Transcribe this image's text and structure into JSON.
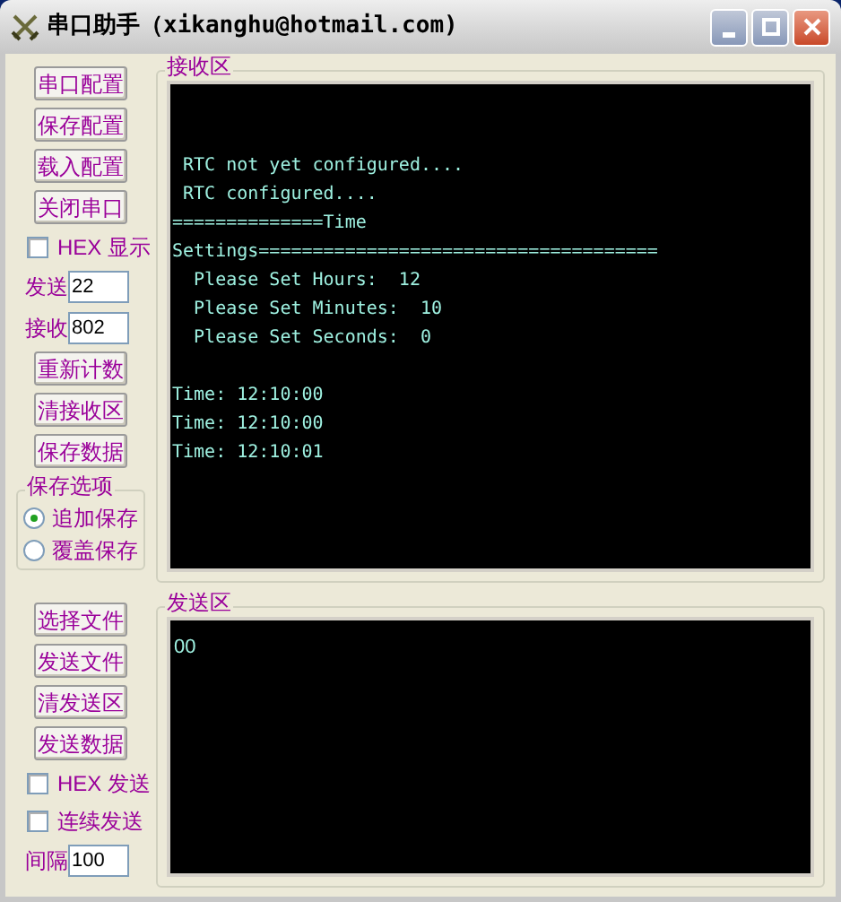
{
  "window": {
    "title": "串口助手（xikanghu@hotmail.com)"
  },
  "top_controls": [
    {
      "kind": "button",
      "label": "串口配置"
    },
    {
      "kind": "button",
      "label": "保存配置"
    },
    {
      "kind": "button",
      "label": "载入配置"
    },
    {
      "kind": "button",
      "label": "关闭串口"
    },
    {
      "kind": "checkbox",
      "label": "HEX 显示",
      "checked": false
    },
    {
      "kind": "field",
      "label": "发送",
      "value": "22"
    },
    {
      "kind": "field",
      "label": "接收",
      "value": "802"
    },
    {
      "kind": "button",
      "label": "重新计数"
    },
    {
      "kind": "button",
      "label": "清接收区"
    },
    {
      "kind": "button",
      "label": "保存数据"
    }
  ],
  "save_options": {
    "title": "保存选项",
    "options": [
      {
        "label": "追加保存",
        "selected": true
      },
      {
        "label": "覆盖保存",
        "selected": false
      }
    ]
  },
  "bottom_controls": [
    {
      "kind": "button",
      "label": "选择文件"
    },
    {
      "kind": "button",
      "label": "发送文件"
    },
    {
      "kind": "button",
      "label": "清发送区"
    },
    {
      "kind": "button",
      "label": "发送数据"
    },
    {
      "kind": "checkbox",
      "label": "HEX 发送",
      "checked": false
    },
    {
      "kind": "checkbox",
      "label": "连续发送",
      "checked": false
    },
    {
      "kind": "field",
      "label": "间隔",
      "value": "100"
    }
  ],
  "receive_area": {
    "title": "接收区",
    "blocks": [
      [
        " RTC not yet configured....",
        " RTC configured....",
        "==============Time",
        "Settings=====================================",
        "  Please Set Hours:  12",
        "  Please Set Minutes:  10",
        "  Please Set Seconds:  0"
      ],
      [
        "Time: 12:10:00",
        "Time: 12:10:00",
        "Time: 12:10:01"
      ]
    ]
  },
  "send_area": {
    "title": "发送区",
    "value": "00"
  }
}
